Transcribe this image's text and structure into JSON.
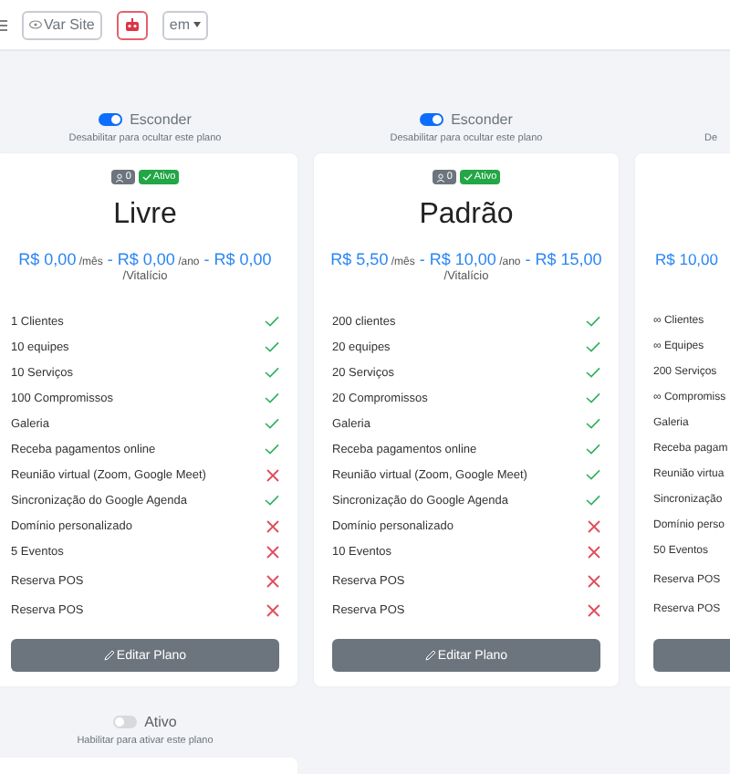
{
  "topbar": {
    "view_site": "Var Site",
    "language": "em"
  },
  "plans": [
    {
      "toggle": {
        "label": "Esconder",
        "on": true,
        "description": "Desabilitar para ocultar este plano"
      },
      "badges": [
        {
          "kind": "users",
          "text": "0"
        },
        {
          "kind": "status",
          "text": "Ativo"
        }
      ],
      "title": "Livre",
      "separator": "-",
      "prices": [
        {
          "amount": "R$ 0,00",
          "period": "/mês"
        },
        {
          "amount": "R$ 0,00",
          "period": "/ano"
        },
        {
          "amount": "R$ 0,00"
        }
      ],
      "lifetime": "/Vitalício",
      "features": [
        {
          "text": "1 Clientes",
          "included": true,
          "kind": "core"
        },
        {
          "text": "10 equipes",
          "included": true,
          "kind": "core"
        },
        {
          "text": "10 Serviços",
          "included": true,
          "kind": "core"
        },
        {
          "text": "100 Compromissos",
          "included": true,
          "kind": "core"
        },
        {
          "text": "Galeria",
          "included": true,
          "kind": "core"
        },
        {
          "text": "Receba pagamentos online",
          "included": true,
          "kind": "core"
        },
        {
          "text": "Reunião virtual (Zoom, Google Meet)",
          "included": false,
          "kind": "core"
        },
        {
          "text": "Sincronização do Google Agenda",
          "included": true,
          "kind": "core"
        },
        {
          "text": "Domínio personalizado",
          "included": false,
          "kind": "core"
        },
        {
          "text": "5 Eventos",
          "included": false,
          "kind": "core"
        },
        {
          "text": "Reserva POS",
          "included": false,
          "kind": "addon"
        },
        {
          "text": "Reserva POS",
          "included": false,
          "kind": "addon"
        }
      ],
      "button": "Editar Plano"
    },
    {
      "toggle": {
        "label": "Esconder",
        "on": true,
        "description": "Desabilitar para ocultar este plano"
      },
      "badges": [
        {
          "kind": "users",
          "text": "0"
        },
        {
          "kind": "status",
          "text": "Ativo"
        }
      ],
      "title": "Padrão",
      "separator": "-",
      "prices": [
        {
          "amount": "R$ 5,50",
          "period": "/mês"
        },
        {
          "amount": "R$ 10,00",
          "period": "/ano"
        },
        {
          "amount": "R$ 15,00"
        }
      ],
      "lifetime": "/Vitalício",
      "features": [
        {
          "text": "200 clientes",
          "included": true,
          "kind": "core"
        },
        {
          "text": "20 equipes",
          "included": true,
          "kind": "core"
        },
        {
          "text": "20 Serviços",
          "included": true,
          "kind": "core"
        },
        {
          "text": "20 Compromissos",
          "included": true,
          "kind": "core"
        },
        {
          "text": "Galeria",
          "included": true,
          "kind": "core"
        },
        {
          "text": "Receba pagamentos online",
          "included": true,
          "kind": "core"
        },
        {
          "text": "Reunião virtual (Zoom, Google Meet)",
          "included": true,
          "kind": "core"
        },
        {
          "text": "Sincronização do Google Agenda",
          "included": true,
          "kind": "core"
        },
        {
          "text": "Domínio personalizado",
          "included": false,
          "kind": "core"
        },
        {
          "text": "10 Eventos",
          "included": false,
          "kind": "core"
        },
        {
          "text": "Reserva POS",
          "included": false,
          "kind": "addon"
        },
        {
          "text": "Reserva POS",
          "included": false,
          "kind": "addon"
        }
      ],
      "button": "Editar Plano"
    },
    {
      "toggle": {
        "description": "De"
      },
      "prices": [
        {
          "amount": "R$ 10,00"
        }
      ],
      "features": [
        {
          "text": "∞ Clientes",
          "kind": "core"
        },
        {
          "text": "∞ Equipes",
          "kind": "core"
        },
        {
          "text": "200 Serviços",
          "kind": "core"
        },
        {
          "text": "∞ Compromiss",
          "kind": "core"
        },
        {
          "text": "Galeria",
          "kind": "core"
        },
        {
          "text": "Receba pagam",
          "kind": "core"
        },
        {
          "text": "Reunião virtua",
          "kind": "core"
        },
        {
          "text": "Sincronização",
          "kind": "core"
        },
        {
          "text": "Domínio perso",
          "kind": "core"
        },
        {
          "text": "50 Eventos",
          "kind": "core"
        },
        {
          "text": "Reserva POS",
          "kind": "addon"
        },
        {
          "text": "Reserva POS",
          "kind": "addon"
        }
      ]
    }
  ],
  "next_row": [
    {
      "toggle": {
        "label": "Ativo",
        "on": false,
        "description": "Habilitar para ativar este plano"
      }
    }
  ]
}
